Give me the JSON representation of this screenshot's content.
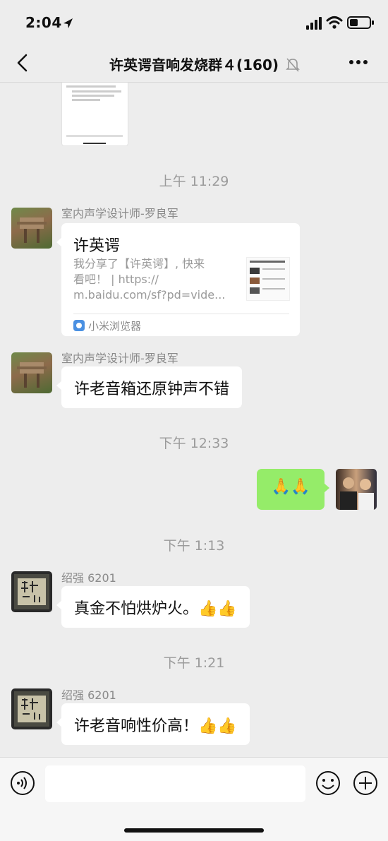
{
  "status": {
    "time": "2:04"
  },
  "header": {
    "title": "许英谔音响发烧群４(160)"
  },
  "chat": {
    "time_1": "上午 11:29",
    "time_2": "下午 12:33",
    "time_3": "下午 1:13",
    "time_4": "下午 1:21",
    "msg1": {
      "sender": "室内声学设计师-罗良军",
      "card_title": "许英谔",
      "card_desc_line1": "我分享了【许英谔】, 快来",
      "card_desc_line2": "看吧！ | https://",
      "card_desc_line3": "m.baidu.com/sf?pd=vide...",
      "card_source": "小米浏览器"
    },
    "msg2": {
      "sender": "室内声学设计师-罗良军",
      "text": "许老音箱还原钟声不错"
    },
    "msg3": {
      "text": "🙏🙏"
    },
    "msg4": {
      "sender": "绍强 6201",
      "text": "真金不怕烘炉火。👍👍"
    },
    "msg5": {
      "sender": "绍强 6201",
      "text": "许老音响性价高！👍👍"
    }
  },
  "icons": {
    "back": "chevron-left-icon",
    "more": "more-dots-icon",
    "mute": "bell-muted-icon",
    "voice": "voice-icon",
    "emoji": "emoji-icon",
    "plus": "plus-icon",
    "browser": "mi-browser-icon"
  },
  "colors": {
    "background": "#ededed",
    "own_bubble": "#95ec69",
    "other_bubble": "#ffffff"
  }
}
